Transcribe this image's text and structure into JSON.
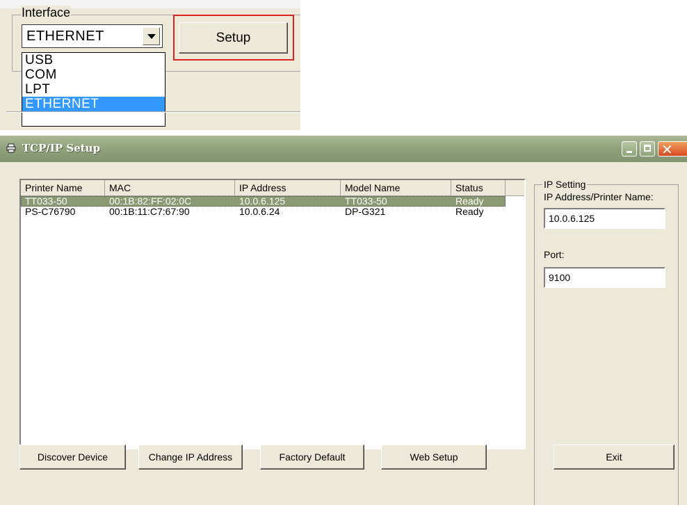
{
  "interface_panel": {
    "legend": "Interface",
    "selected": "ETHERNET",
    "setup_label": "Setup",
    "options": [
      "USB",
      "COM",
      "LPT",
      "ETHERNET"
    ]
  },
  "window": {
    "title": "TCP/IP Setup",
    "close_glyph": "✕"
  },
  "printer_list": {
    "columns": [
      "Printer Name",
      "MAC",
      "IP Address",
      "Model Name",
      "Status"
    ],
    "rows": [
      {
        "name": "TT033-50",
        "mac": "00:1B:82:FF:02:0C",
        "ip": "10.0.6.125",
        "model": "TT033-50",
        "status": "Ready",
        "selected": true
      },
      {
        "name": "PS-C76790",
        "mac": "00:1B:11:C7:67:90",
        "ip": "10.0.6.24",
        "model": "DP-G321",
        "status": "Ready",
        "selected": false
      }
    ]
  },
  "ip_setting": {
    "legend": "IP Setting",
    "address_label": "IP Address/Printer Name:",
    "address_value": "10.0.6.125",
    "port_label": "Port:",
    "port_value": "9100"
  },
  "buttons": {
    "discover": "Discover Device",
    "change_ip": "Change IP Address",
    "factory_default": "Factory Default",
    "web_setup": "Web Setup",
    "exit": "Exit"
  }
}
